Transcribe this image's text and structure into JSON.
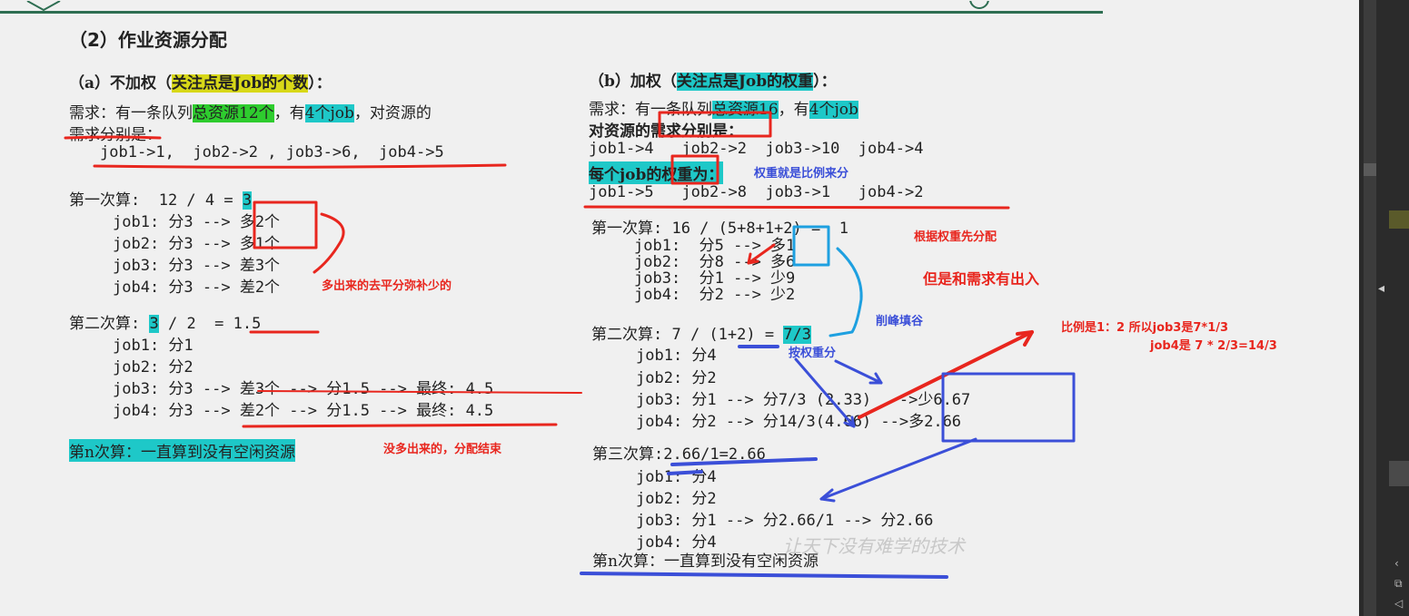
{
  "section_title": "（2）作业资源分配",
  "left": {
    "heading_pre": "（a）不加权（",
    "heading_hl": "关注点是Job的个数",
    "heading_post": "）：",
    "req_pre": "需求：有一条队列",
    "req_hl1": "总资源12个",
    "req_mid": "，有",
    "req_hl2": "4个job",
    "req_post": "，对资源的",
    "req_line2": "需求分别是：",
    "demands": "job1->1,  job2->2 , job3->6,  job4->5",
    "round1_pre": "第一次算:  12 / 4 = ",
    "round1_hl": "3",
    "round1_lines": [
      "job1: 分3 --> 多2个",
      "job2: 分3 --> 多1个",
      "job3: 分3 --> 差3个",
      "job4: 分3 --> 差2个"
    ],
    "round2_pre": "第二次算: ",
    "round2_hl": "3",
    "round2_post": " / 2  = 1.5",
    "round2_lines": [
      "job1: 分1",
      "job2: 分2",
      "job3: 分3 --> 差3个 --> 分1.5 --> 最终: 4.5",
      "job4: 分3 --> 差2个 --> 分1.5 --> 最终: 4.5"
    ],
    "roundn": "第n次算：一直算到没有空闲资源",
    "note_surplus": "多出来的去平分弥补少的",
    "note_end": "没多出来的，分配结束"
  },
  "right": {
    "heading_pre": "（b）加权（",
    "heading_hl": "关注点是Job的权重",
    "heading_post": "）：",
    "req_pre": "需求：有一条队列",
    "req_hl1": "总资源16",
    "req_mid": "，有",
    "req_hl2": "4个job",
    "req_line2": "对资源的需求分别是：",
    "demands": "job1->4   job2->2  job3->10  job4->4",
    "weights_hl": "每个job的权重为：",
    "weights_note": "权重就是比例来分",
    "weights": "job1->5   job2->8  job3->1   job4->2",
    "round1": "第一次算: 16 / (5+8+1+2) =  1",
    "round1_lines": [
      "job1:  分5 --> 多1",
      "job2:  分8 --> 多6",
      "job3:  分1 --> 少9",
      "job4:  分2 --> 少2"
    ],
    "note_weight_first": "根据权重先分配",
    "note_mismatch": "但是和需求有出入",
    "note_peak": "削峰填谷",
    "round2_pre": "第二次算: 7 / (1+2) = ",
    "round2_hl": "7/3",
    "note_by_weight": "按权重分",
    "round2_lines": [
      "job1: 分4",
      "job2: 分2",
      "job3: 分1 --> 分7/3 (2.33)  -->少6.67",
      "job4: 分2 --> 分14/3(4.66) -->多2.66"
    ],
    "note_ratio1": "比例是1：2 所以job3是7*1/3",
    "note_ratio2": "job4是 7 * 2/3=14/3",
    "round3": "第三次算:2.66/1=2.66",
    "round3_lines": [
      "job1: 分4",
      "job2: 分2",
      "job3: 分1 --> 分2.66/1 --> 分2.66",
      "job4: 分4"
    ],
    "roundn": "第n次算：一直算到没有空闲资源",
    "watermark": "让天下没有难学的技术"
  },
  "colors": {
    "red": "#e8261e",
    "blue": "#3b4fd8",
    "cyan_box": "#1ea0e0",
    "highlight_yellow": "#d8d818",
    "highlight_green": "#2ecc2e",
    "highlight_cyan": "#1ec8c8",
    "topbar": "#2e6e52"
  }
}
